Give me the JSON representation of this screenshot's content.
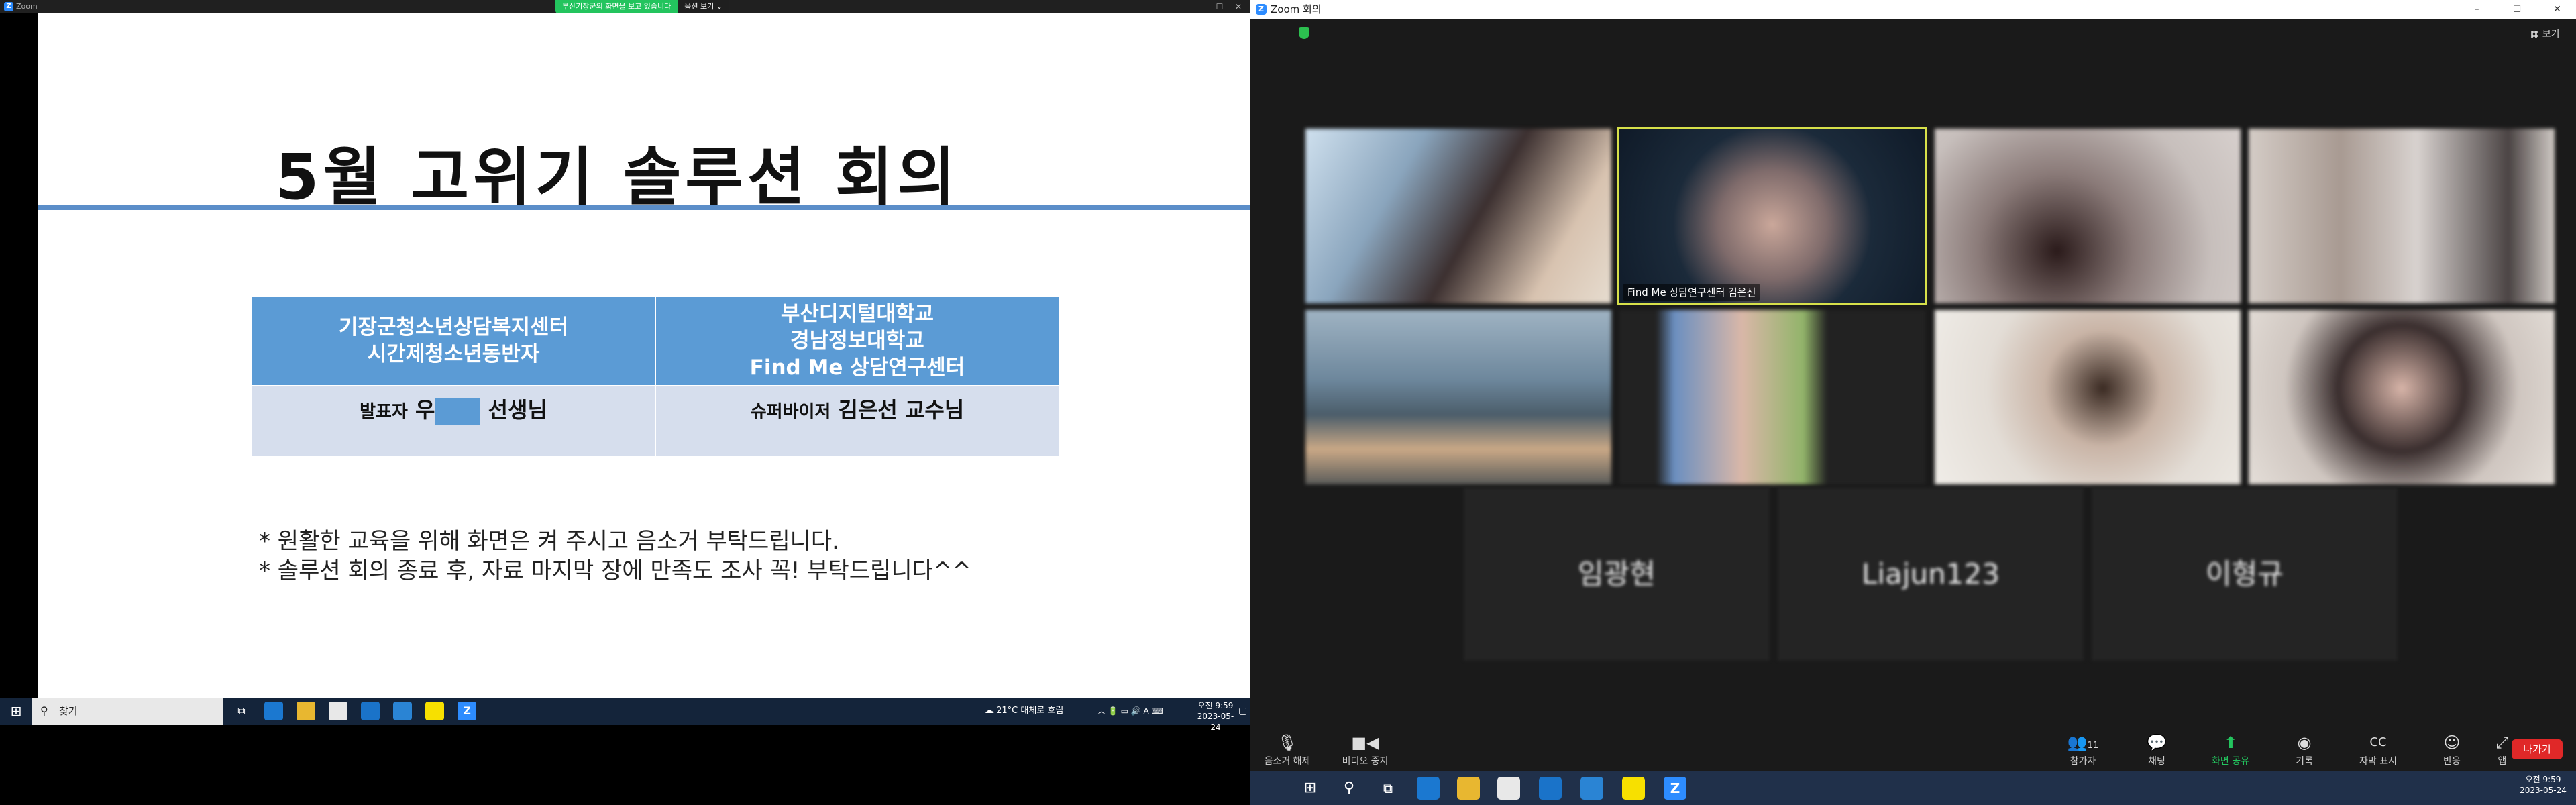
{
  "left_window": {
    "title": "Zoom",
    "share_notice": "부산기장군의 화면을 보고 있습니다",
    "view_options": "옵션 보기",
    "min": "–",
    "max": "☐",
    "close": "✕"
  },
  "slide": {
    "title": "5월 고위기 솔루션 회의",
    "table": {
      "col1_header": [
        "기장군청소년상담복지센터",
        "시간제청소년동반자"
      ],
      "col2_header": [
        "부산디지털대학교",
        "경남정보대학교",
        "Find Me 상담연구센터"
      ],
      "presenter_role": "발표자",
      "presenter_name_prefix": "우",
      "presenter_name_suffix": "선생님",
      "supervisor_role": "슈퍼바이저",
      "supervisor_name": "김은선 교수님"
    },
    "notes": [
      "* 원활한 교육을 위해 화면은 켜 주시고 음소거 부탁드립니다.",
      "* 솔루션 회의 종료 후, 자료 마지막 장에 만족도 조사 꼭! 부탁드립니다^^"
    ]
  },
  "left_taskbar": {
    "search_label": "찾기",
    "weather": "21°C 대체로 흐림",
    "time": "오전 9:59",
    "date": "2023-05-24"
  },
  "right_window": {
    "title": "Zoom 회의",
    "view_label": "보기",
    "min": "–",
    "max": "☐",
    "close": "✕",
    "active_speaker_label": "Find Me 상담연구센터 김은선",
    "name_tiles": [
      "임광현",
      "Liajun123",
      "이형규"
    ]
  },
  "controls": {
    "mute": "음소거 해제",
    "video": "비디오 중지",
    "participants": "참가자",
    "participants_count": "11",
    "chat": "채팅",
    "share": "화면 공유",
    "record": "기록",
    "captions": "자막 표시",
    "reactions": "반응",
    "apps": "앱",
    "leave": "나가기"
  },
  "right_taskbar": {
    "time": "오전 9:59",
    "date": "2023-05-24"
  },
  "colors": {
    "slide_blue": "#5b9bd5",
    "slide_light": "#d6deed",
    "zoom_green": "#23c45e",
    "leave_red": "#e02828",
    "active_outline": "#d7e04a"
  }
}
